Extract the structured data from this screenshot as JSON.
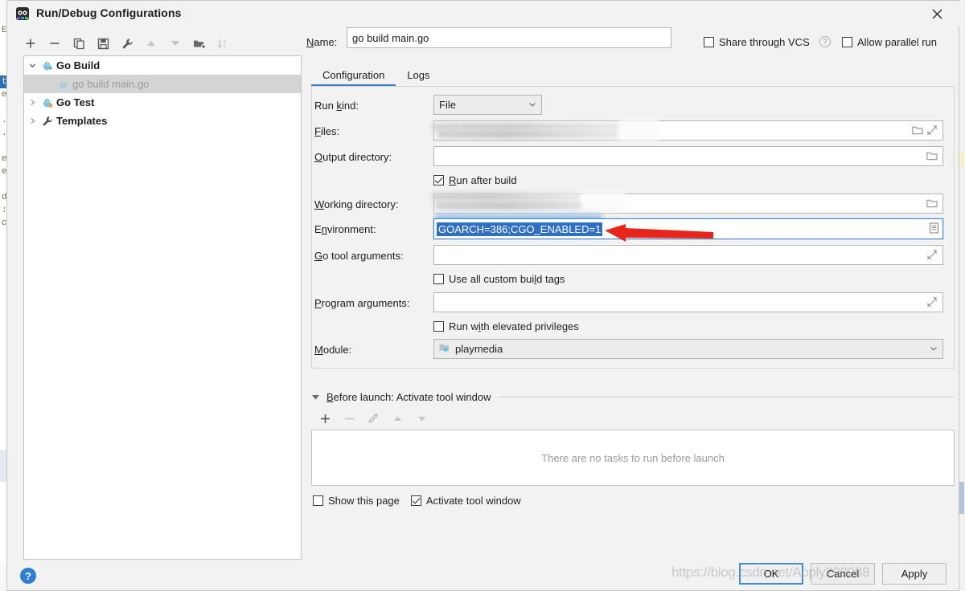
{
  "window": {
    "title": "Run/Debug Configurations",
    "app_icon": "intellij-goland-icon",
    "close_icon": "close-icon"
  },
  "left_toolbar": {
    "buttons": [
      {
        "name": "add-configuration-button",
        "icon": "plus-icon",
        "label": "+"
      },
      {
        "name": "remove-configuration-button",
        "icon": "minus-icon",
        "label": "−"
      },
      {
        "name": "copy-configuration-button",
        "icon": "copy-icon",
        "label": ""
      },
      {
        "name": "save-configuration-button",
        "icon": "save-icon",
        "label": ""
      },
      {
        "name": "edit-templates-button",
        "icon": "wrench-icon",
        "label": ""
      },
      {
        "name": "move-up-button",
        "icon": "arrow-up-icon",
        "label": ""
      },
      {
        "name": "move-down-button",
        "icon": "arrow-down-icon",
        "label": ""
      },
      {
        "name": "new-folder-button",
        "icon": "folder-add-icon",
        "label": ""
      },
      {
        "name": "sort-alphabetically-button",
        "icon": "sort-az-icon",
        "label": ""
      }
    ]
  },
  "tree": {
    "items": [
      {
        "label": "Go Build",
        "icon": "go-gopher-icon",
        "expanded": true,
        "level": 0,
        "selected": false,
        "arrow": "chevron-down-icon"
      },
      {
        "label": "go build main.go",
        "icon": "go-gopher-icon",
        "level": 1,
        "selected": true,
        "arrow": ""
      },
      {
        "label": "Go Test",
        "icon": "go-gopher-test-icon",
        "expanded": false,
        "level": 0,
        "selected": false,
        "arrow": "chevron-right-icon"
      },
      {
        "label": "Templates",
        "icon": "wrench-icon",
        "expanded": false,
        "level": 0,
        "selected": false,
        "arrow": "chevron-right-icon"
      }
    ]
  },
  "help_button": {
    "label": "?",
    "icon": "help-icon"
  },
  "header": {
    "name_label": "Name:",
    "name_value": "go build main.go",
    "name_placeholder": "",
    "share_vcs_label": "Share through VCS",
    "share_vcs_checked": false,
    "share_help_label": "?",
    "allow_parallel_label": "Allow parallel run",
    "allow_parallel_checked": false
  },
  "tabs": [
    {
      "label": "Configuration",
      "active": true
    },
    {
      "label": "Logs",
      "active": false
    }
  ],
  "config": {
    "run_kind_label": "Run kind:",
    "run_kind_value": "File",
    "run_kind_caret_icon": "chevron-down-icon",
    "files_label": "Files:",
    "files_value": "",
    "files_browse_icon": "folder-icon",
    "files_expand_icon": "expand-icon",
    "output_dir_label": "Output directory:",
    "output_dir_value": "",
    "output_dir_browse_icon": "folder-icon",
    "run_after_build_label": "Run after build",
    "run_after_build_checked": true,
    "working_dir_label": "Working directory:",
    "working_dir_value": "",
    "working_dir_browse_icon": "folder-icon",
    "environment_label": "Environment:",
    "environment_value": "GOARCH=386;CGO_ENABLED=1",
    "environment_edit_icon": "list-edit-icon",
    "go_tool_args_label": "Go tool arguments:",
    "go_tool_args_value": "",
    "go_tool_args_expand_icon": "expand-icon",
    "custom_build_tags_label": "Use all custom build tags",
    "custom_build_tags_checked": false,
    "program_args_label": "Program arguments:",
    "program_args_value": "",
    "program_args_expand_icon": "expand-icon",
    "elevated_label": "Run with elevated privileges",
    "elevated_checked": false,
    "module_label": "Module:",
    "module_value": "playmedia",
    "module_icon": "module-folder-icon",
    "module_caret_icon": "chevron-down-icon"
  },
  "before_launch": {
    "title": "Before launch: Activate tool window",
    "collapse_icon": "triangle-down-icon",
    "toolbar": [
      {
        "name": "add-task-button",
        "icon": "plus-icon"
      },
      {
        "name": "remove-task-button",
        "icon": "minus-icon"
      },
      {
        "name": "edit-task-button",
        "icon": "pencil-icon"
      },
      {
        "name": "task-move-up-button",
        "icon": "arrow-up-icon"
      },
      {
        "name": "task-move-down-button",
        "icon": "arrow-down-icon"
      }
    ],
    "empty_text": "There are no tasks to run before launch",
    "show_page_label": "Show this page",
    "show_page_checked": false,
    "activate_tool_window_label": "Activate tool window",
    "activate_tool_window_checked": true
  },
  "footer": {
    "ok_label": "OK",
    "cancel_label": "Cancel",
    "apply_label": "Apply"
  },
  "annotation": {
    "arrow_color": "#e8251a",
    "points_to": "environment-field"
  },
  "watermark": {
    "text": "https://blog.csdn.net/Apply208988"
  },
  "colors": {
    "accent": "#3c81c9",
    "selection": "#2f6fc4",
    "dialog_bg": "#f2f2f2",
    "field_bg": "#ffffff",
    "disabled_bg": "#ececec",
    "arrow_red": "#e8251a"
  },
  "background_editor": {
    "lines": [
      "ET",
      "",
      "",
      "",
      "t_E",
      "et",
      "",
      ". c",
      ". c",
      "",
      "et",
      "et",
      "",
      "d",
      ":",
      "c"
    ]
  }
}
